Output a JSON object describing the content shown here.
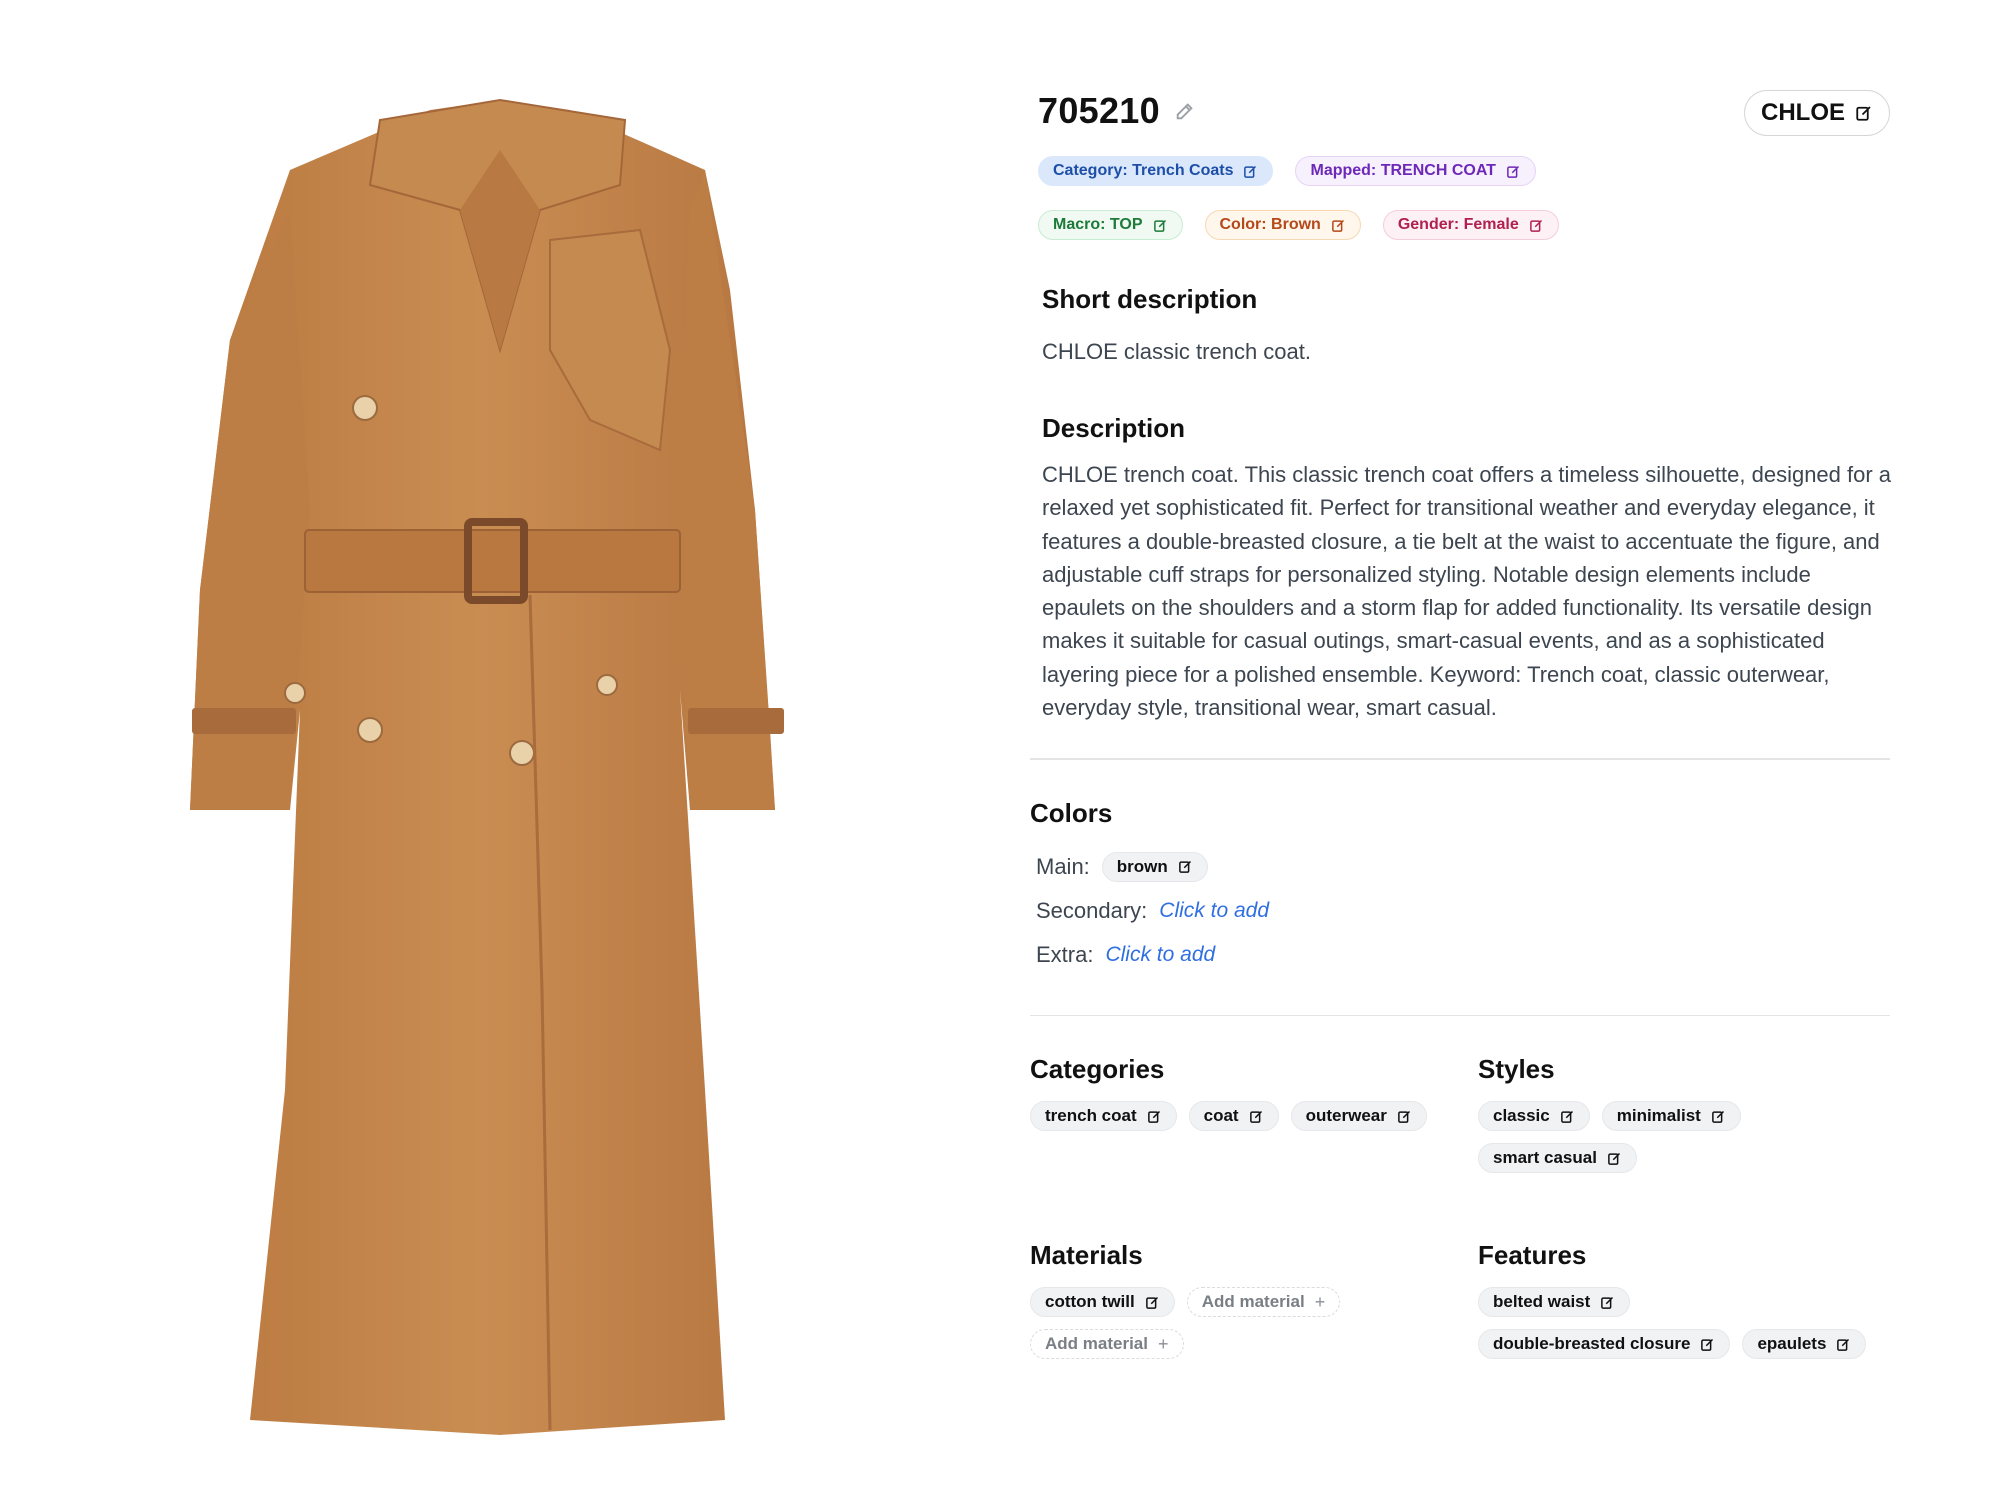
{
  "product": {
    "sku": "705210",
    "brand": "CHLOE"
  },
  "tags": [
    {
      "label": "Category: Trench Coats",
      "color": "#1d4fa8"
    },
    {
      "label": "Mapped: TRENCH COAT",
      "color": "#6d28b8"
    },
    {
      "label": "Macro: TOP",
      "color": "#1d7a39"
    },
    {
      "label": "Color: Brown",
      "color": "#b4491a"
    },
    {
      "label": "Gender: Female",
      "color": "#b0214f"
    }
  ],
  "short_description": {
    "title": "Short description",
    "text": "CHLOE classic trench coat."
  },
  "description": {
    "title": "Description",
    "text": "CHLOE trench coat. This classic trench coat offers a timeless silhouette, designed for a relaxed yet sophisticated fit. Perfect for transitional weather and everyday elegance, it features a double-breasted closure, a tie belt at the waist to accentuate the figure, and adjustable cuff straps for personalized styling. Notable design elements include epaulets on the shoulders and a storm flap for added functionality. Its versatile design makes it suitable for casual outings, smart-casual events, and as a sophisticated layering piece for a polished ensemble. Keyword: Trench coat, classic outerwear, everyday style, transitional wear, smart casual."
  },
  "colors": {
    "title": "Colors",
    "main_label": "Main:",
    "main_value": "brown",
    "secondary_label": "Secondary:",
    "secondary_action": "Click to add",
    "extra_label": "Extra:",
    "extra_action": "Click to add"
  },
  "categories": {
    "title": "Categories",
    "items": [
      "trench coat",
      "coat",
      "outerwear"
    ]
  },
  "styles": {
    "title": "Styles",
    "items": [
      "classic",
      "minimalist",
      "smart casual"
    ]
  },
  "materials": {
    "title": "Materials",
    "items": [
      "cotton twill"
    ],
    "add_label": "Add material"
  },
  "features": {
    "title": "Features",
    "items": [
      "belted waist",
      "double-breasted closure",
      "epaulets"
    ]
  },
  "icons": {
    "edit": "edit-icon",
    "add": "plus-icon"
  },
  "accent": "#2f6fe0"
}
